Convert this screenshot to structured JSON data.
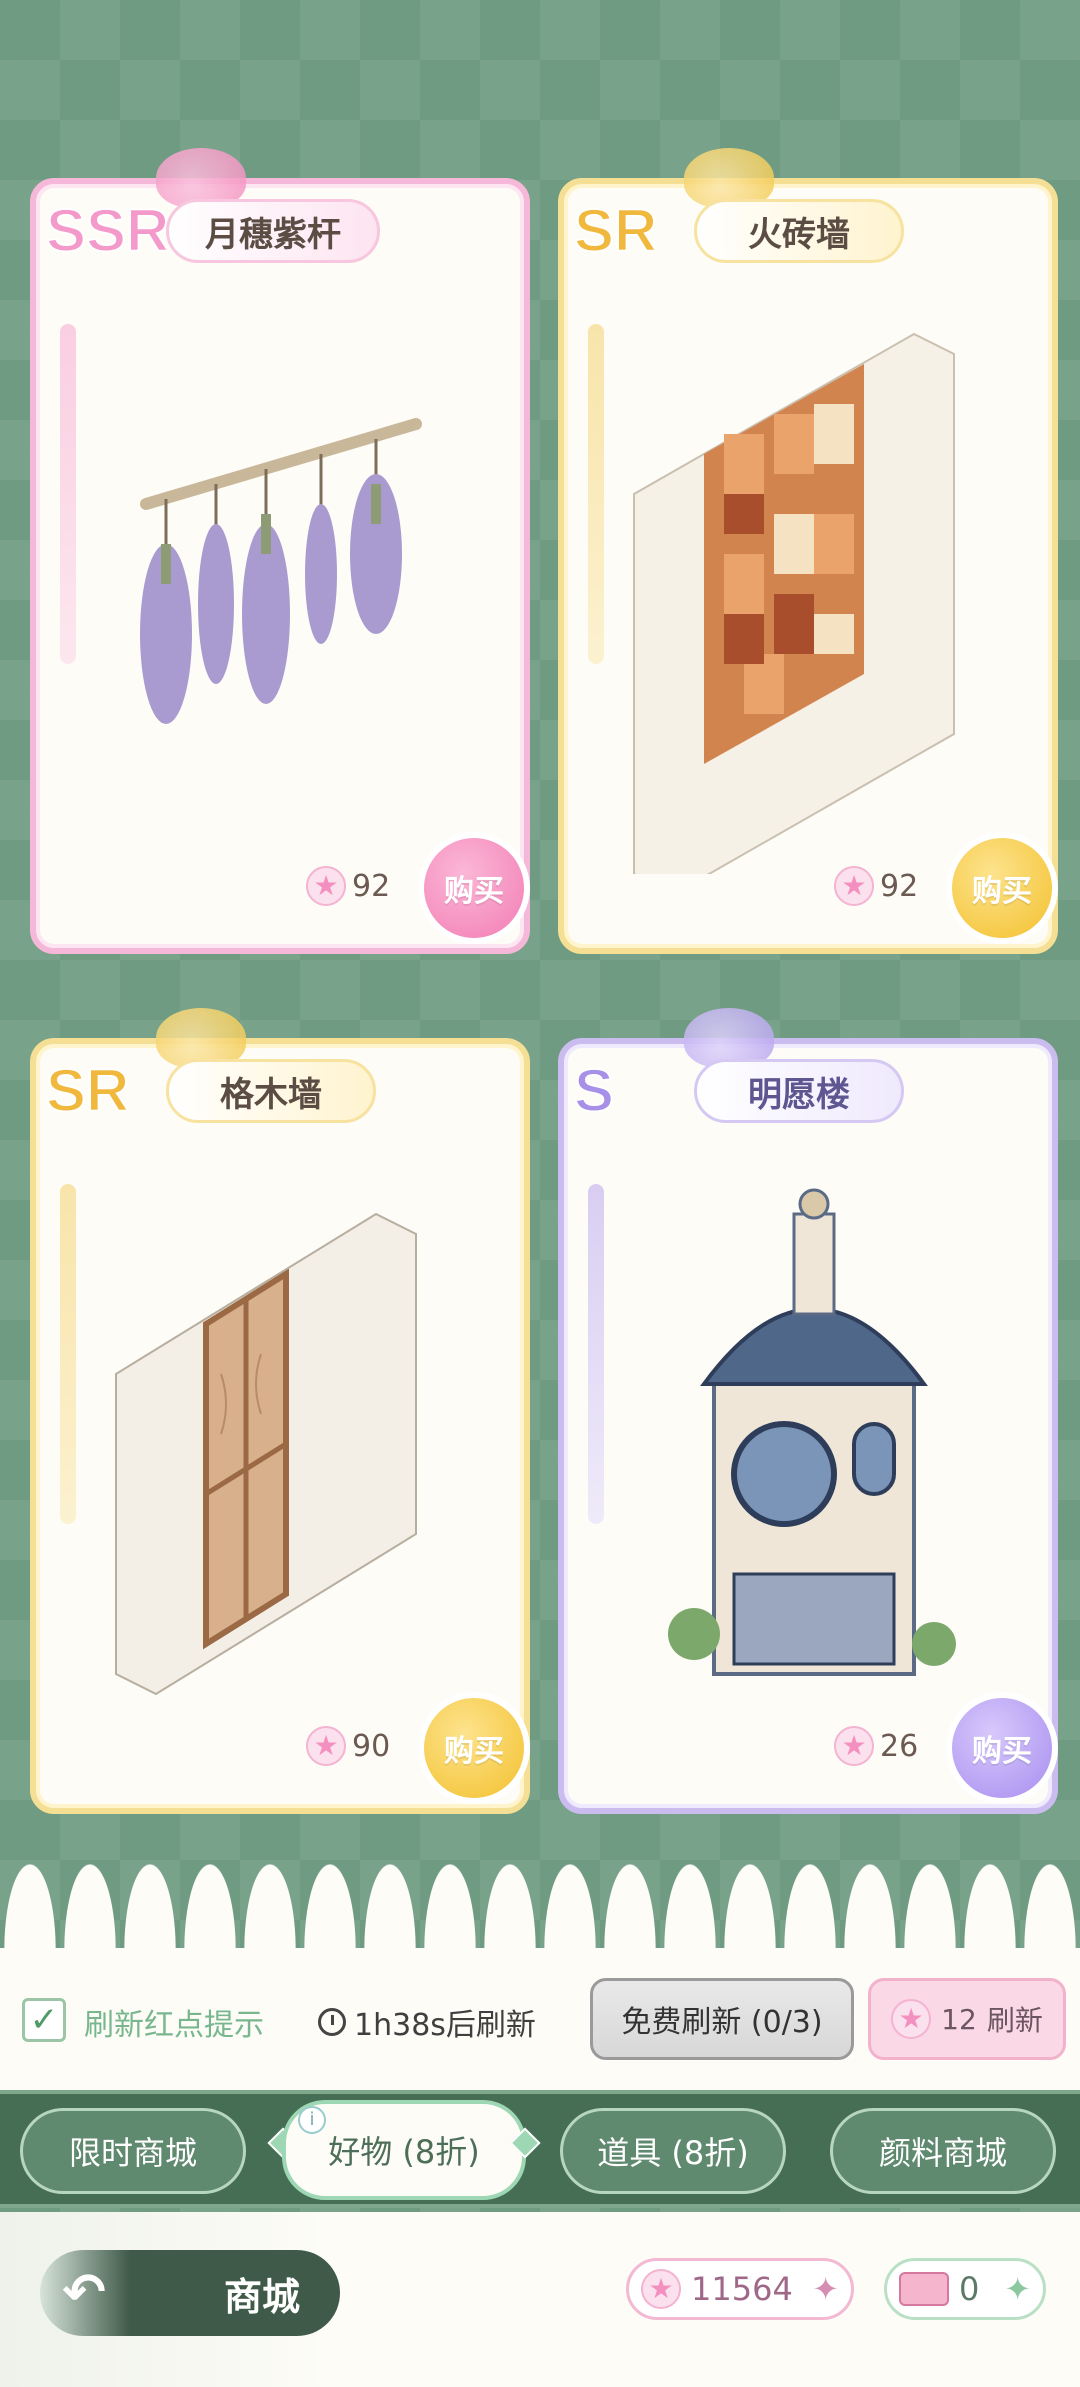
{
  "cards": [
    {
      "rarity": "SSR",
      "name": "月穗紫杆",
      "price": "92",
      "buy_label": "购买",
      "art": "lavender-hanger"
    },
    {
      "rarity": "SR",
      "name": "火砖墙",
      "price": "92",
      "buy_label": "购买",
      "art": "brick-wall"
    },
    {
      "rarity": "SR",
      "name": "格木墙",
      "price": "90",
      "buy_label": "购买",
      "art": "wood-wall"
    },
    {
      "rarity": "S",
      "name": "明愿楼",
      "price": "26",
      "buy_label": "购买",
      "art": "mansion"
    }
  ],
  "refresh": {
    "checkbox_label": "刷新红点提示",
    "checked": true,
    "timer": "1h38s后刷新",
    "free_refresh": "免费刷新 (0/3)",
    "paid_refresh_cost": "12",
    "paid_refresh_label": "刷新"
  },
  "tabs": [
    {
      "label": "限时商城",
      "active": false
    },
    {
      "label": "好物 (8折)",
      "active": true
    },
    {
      "label": "道具 (8折)",
      "active": false
    },
    {
      "label": "颜料商城",
      "active": false
    }
  ],
  "footer": {
    "title": "商城",
    "star_currency": "11564",
    "ticket_currency": "0"
  },
  "icons": {
    "star": "star-icon",
    "clock": "clock-icon",
    "back": "back-arrow-icon",
    "check": "checkmark-icon",
    "ticket": "ticket-icon",
    "info": "info-icon"
  },
  "colors": {
    "background": "#6f9b82",
    "ssr": "#f39acb",
    "sr": "#f0b93e",
    "s": "#a791e8",
    "tab_bar": "#456e55"
  }
}
